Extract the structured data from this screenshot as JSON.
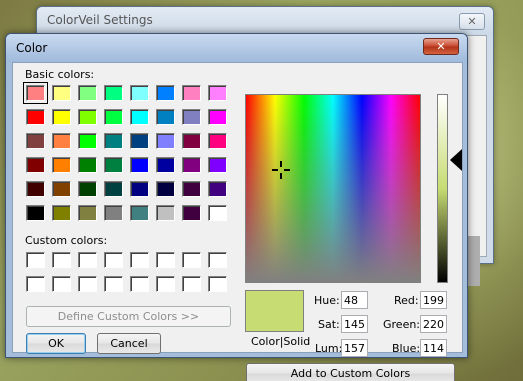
{
  "background_window": {
    "title": "ColorVeil Settings",
    "close_glyph": "✕",
    "partial_letter": "t"
  },
  "dialog": {
    "title": "Color",
    "close_glyph": "✕",
    "basic_colors_label": "Basic colors:",
    "custom_colors_label": "Custom colors:",
    "define_custom_button": "Define Custom Colors >>",
    "ok_button": "OK",
    "cancel_button": "Cancel",
    "add_custom_button": "Add to Custom Colors",
    "preview_label": "Color|Solid",
    "preview_color": "#c7dc72",
    "selected_basic_index": 0,
    "fields": {
      "hue_label": "Hue:",
      "hue": "48",
      "sat_label": "Sat:",
      "sat": "145",
      "lum_label": "Lum:",
      "lum": "157",
      "red_label": "Red:",
      "red": "199",
      "green_label": "Green:",
      "green": "220",
      "blue_label": "Blue:",
      "blue": "114"
    }
  },
  "basic_colors": [
    "#ff8080",
    "#ffff80",
    "#80ff80",
    "#00ff80",
    "#80ffff",
    "#0080ff",
    "#ff80c0",
    "#ff80ff",
    "#ff0000",
    "#ffff00",
    "#80ff00",
    "#00ff40",
    "#00ffff",
    "#0080c0",
    "#8080c0",
    "#ff00ff",
    "#804040",
    "#ff8040",
    "#00ff00",
    "#008080",
    "#004080",
    "#8080ff",
    "#800040",
    "#ff0080",
    "#800000",
    "#ff8000",
    "#008000",
    "#008040",
    "#0000ff",
    "#0000a0",
    "#800080",
    "#8000ff",
    "#400000",
    "#804000",
    "#004000",
    "#004040",
    "#000080",
    "#000040",
    "#400040",
    "#400080",
    "#000000",
    "#808000",
    "#808040",
    "#808080",
    "#408080",
    "#c0c0c0",
    "#400040",
    "#ffffff"
  ],
  "custom_colors": [
    "#ffffff",
    "#ffffff",
    "#ffffff",
    "#ffffff",
    "#ffffff",
    "#ffffff",
    "#ffffff",
    "#ffffff",
    "#ffffff",
    "#ffffff",
    "#ffffff",
    "#ffffff",
    "#ffffff",
    "#ffffff",
    "#ffffff",
    "#ffffff"
  ],
  "spectrum_selection": {
    "hue_fraction": 0.2,
    "sat_fraction": 0.6
  },
  "luminance_level": 0.65
}
